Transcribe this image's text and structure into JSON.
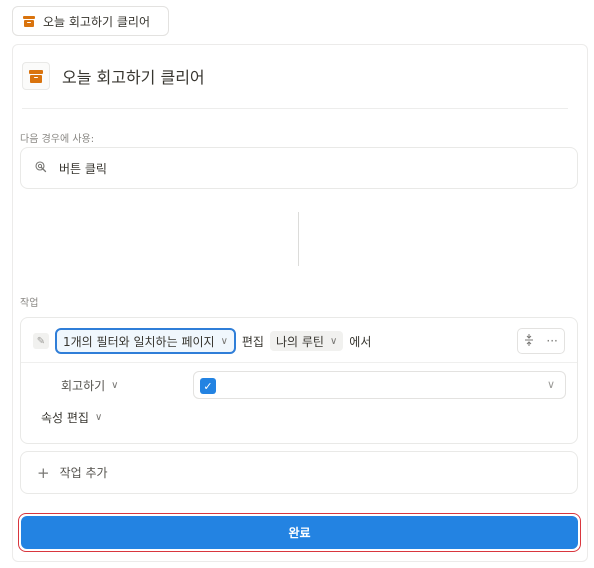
{
  "top_chip": {
    "label": "오늘 회고하기 클리어",
    "icon": "archive-box-icon"
  },
  "header": {
    "title": "오늘 회고하기 클리어",
    "icon": "archive-box-icon"
  },
  "trigger": {
    "section_label": "다음 경우에 사용:",
    "label": "버튼 클릭",
    "icon": "cursor-click-icon"
  },
  "actions": {
    "section_label": "작업",
    "filter_pill": "1개의 필터와 일치하는 페이지",
    "edit_text": "편집",
    "database_label": "나의 루틴",
    "in_text": "에서",
    "property": {
      "label": "회고하기",
      "checked": true
    },
    "edit_properties_label": "속성 편집"
  },
  "add_action": {
    "label": "작업 추가"
  },
  "done_button": {
    "label": "완료"
  },
  "colors": {
    "accent": "#2383e2",
    "brand_orange": "#d9730d",
    "focus_outline": "#d9363e"
  }
}
